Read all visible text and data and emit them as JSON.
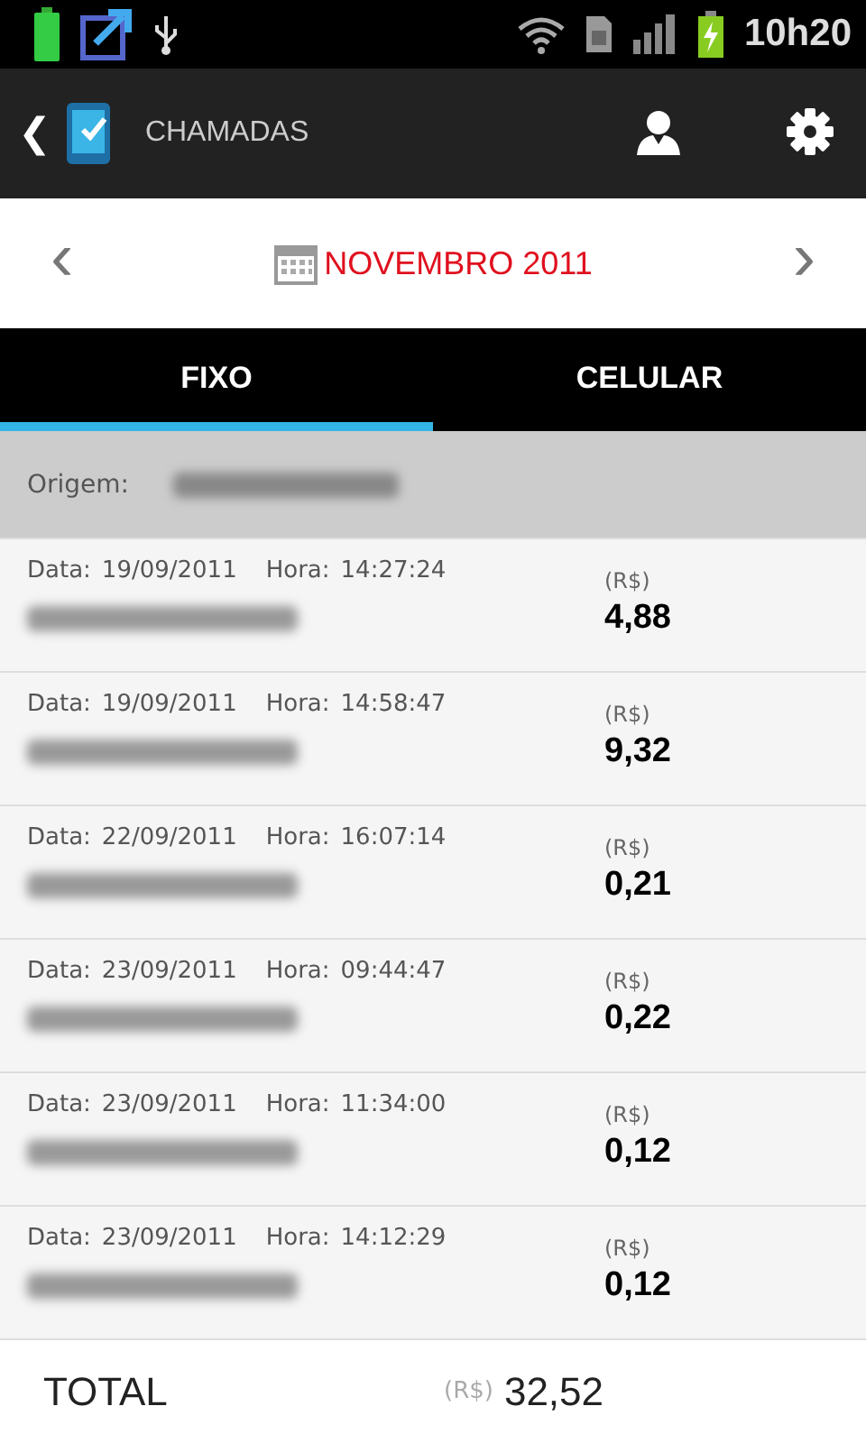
{
  "status_bar": {
    "time": "10h20"
  },
  "action_bar": {
    "back": "❮",
    "title": "CHAMADAS"
  },
  "month_nav": {
    "prev": "‹",
    "label": "NOVEMBRO 2011",
    "next": "›"
  },
  "tabs": [
    {
      "label": "FIXO",
      "selected": true
    },
    {
      "label": "CELULAR",
      "selected": false
    }
  ],
  "origin": {
    "label": "Origem:"
  },
  "calls": [
    {
      "date_label": "Data:",
      "date": "19/09/2011",
      "time_label": "Hora:",
      "time": "14:27:24",
      "currency": "(R$)",
      "amount": "4,88"
    },
    {
      "date_label": "Data:",
      "date": "19/09/2011",
      "time_label": "Hora:",
      "time": "14:58:47",
      "currency": "(R$)",
      "amount": "9,32"
    },
    {
      "date_label": "Data:",
      "date": "22/09/2011",
      "time_label": "Hora:",
      "time": "16:07:14",
      "currency": "(R$)",
      "amount": "0,21"
    },
    {
      "date_label": "Data:",
      "date": "23/09/2011",
      "time_label": "Hora:",
      "time": "09:44:47",
      "currency": "(R$)",
      "amount": "0,22"
    },
    {
      "date_label": "Data:",
      "date": "23/09/2011",
      "time_label": "Hora:",
      "time": "11:34:00",
      "currency": "(R$)",
      "amount": "0,12"
    },
    {
      "date_label": "Data:",
      "date": "23/09/2011",
      "time_label": "Hora:",
      "time": "14:12:29",
      "currency": "(R$)",
      "amount": "0,12"
    }
  ],
  "total": {
    "label": "TOTAL",
    "currency": "(R$)",
    "amount": "32,52"
  }
}
